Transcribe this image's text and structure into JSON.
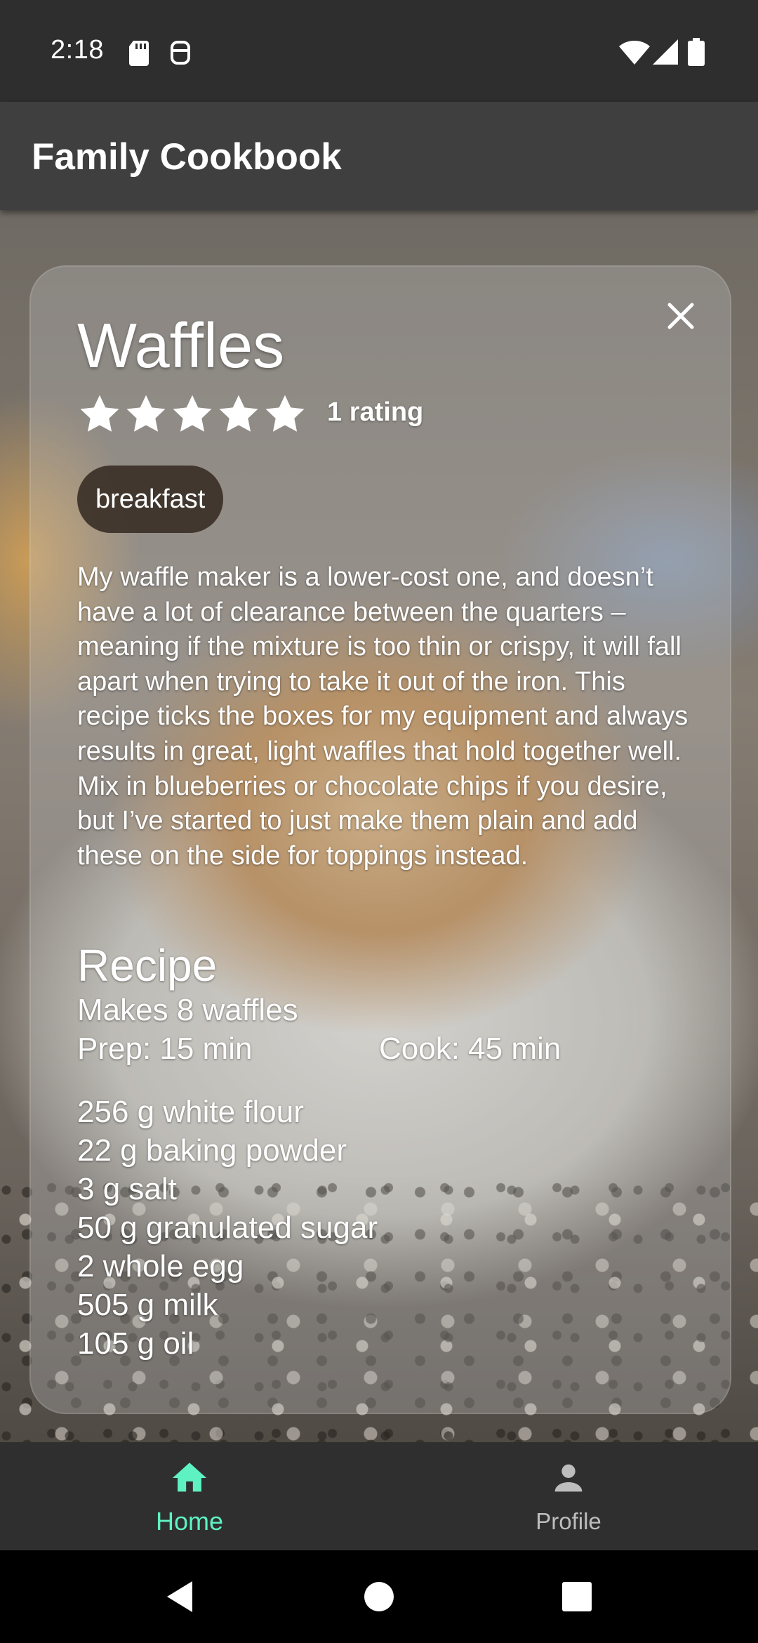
{
  "status_bar": {
    "time": "2:18"
  },
  "app_bar": {
    "title": "Family Cookbook"
  },
  "recipe": {
    "title": "Waffles",
    "rating_stars": 5,
    "rating_text": "1 rating",
    "tag": "breakfast",
    "description": "My waffle maker is a lower-cost one, and doesn’t have a lot of clearance between the quarters – meaning if the mixture is too thin or crispy, it will fall apart when trying to take it out of the iron. This recipe ticks the boxes for my equipment and always results in great, light waffles that hold together well. Mix in blueberries or chocolate chips if you desire, but I’ve started to just make them plain and add these on the side for toppings instead.",
    "section_heading": "Recipe",
    "makes": "Makes 8 waffles",
    "prep": "Prep: 15 min",
    "cook": "Cook: 45 min",
    "ingredients": [
      "256 g white flour",
      "22 g baking powder",
      "3 g salt",
      "50 g granulated sugar",
      "2 whole egg",
      "505 g milk",
      "105 g oil"
    ]
  },
  "bottom_nav": {
    "items": [
      {
        "label": "Home",
        "icon": "home-icon",
        "active": true
      },
      {
        "label": "Profile",
        "icon": "person-icon",
        "active": false
      }
    ]
  },
  "colors": {
    "accent": "#5ef2c3",
    "app_bar": "#3f3f3f",
    "status_bar": "#2e2e2e",
    "nav_bar": "#2f2f2f"
  }
}
